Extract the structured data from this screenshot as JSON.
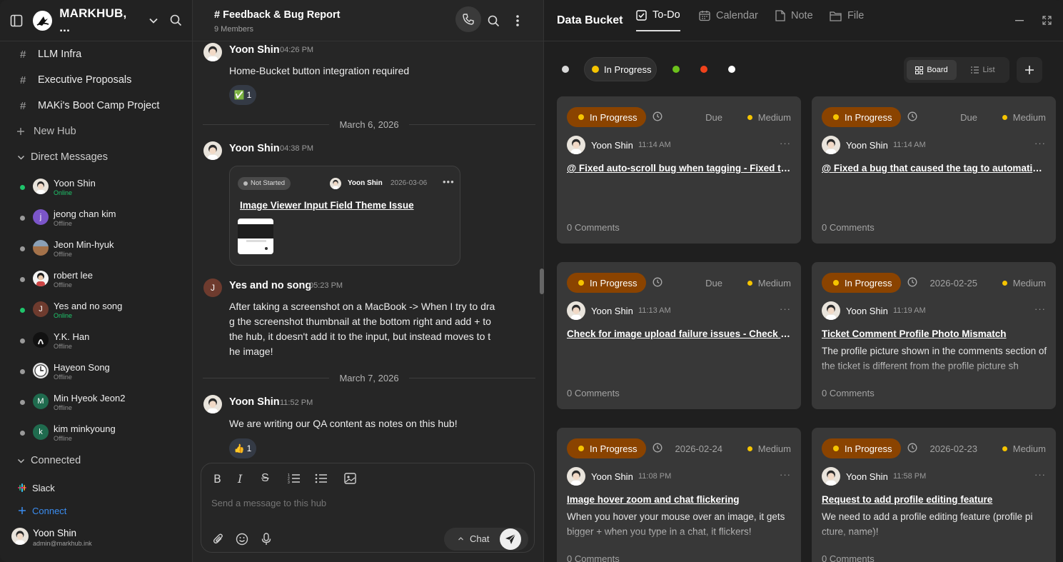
{
  "sidebar": {
    "workspace": "MARKHUB, ...",
    "channels": [
      {
        "label": "LLM Infra"
      },
      {
        "label": "Executive Proposals"
      },
      {
        "label": "MAKi's Boot Camp Project"
      }
    ],
    "new_hub": "New Hub",
    "direct_messages": "Direct Messages",
    "dms": [
      {
        "name": "Yoon Shin",
        "status": "Online"
      },
      {
        "name": "jeong chan kim",
        "status": "Offline"
      },
      {
        "name": "Jeon Min-hyuk",
        "status": "Offline"
      },
      {
        "name": "robert lee",
        "status": "Offline"
      },
      {
        "name": "Yes and no song",
        "status": "Online"
      },
      {
        "name": "Y.K. Han",
        "status": "Offline"
      },
      {
        "name": "Hayeon Song",
        "status": "Offline"
      },
      {
        "name": "Min Hyeok Jeon2",
        "status": "Offline"
      },
      {
        "name": "kim minkyoung",
        "status": "Offline"
      }
    ],
    "connected": "Connected",
    "slack": "Slack",
    "connect": "Connect",
    "user": {
      "name": "Yoon Shin",
      "email": "admin@markhub.ink"
    }
  },
  "chat": {
    "title": "# Feedback & Bug Report",
    "members": "9 Members",
    "messages": [
      {
        "name": "Yoon Shin",
        "time": "04:26 PM",
        "text": "Home-Bucket button integration required",
        "reaction": "✅",
        "count": "1"
      },
      {
        "name": "Yoon Shin",
        "time": "04:38 PM"
      },
      {
        "name": "Yes and no song",
        "time": "05:23 PM",
        "text": "After taking a screenshot on a MacBook -> When I try to dra g the screenshot thumbnail at the bottom right and add + to the hub, it doesn't add it to the input, but instead moves to t he image!"
      },
      {
        "name": "Yoon Shin",
        "time": "11:52 PM",
        "text": "We are writing our QA content as notes on this hub!",
        "reaction": "👍",
        "count": "1"
      }
    ],
    "dates": [
      "March 6, 2026",
      "March 7, 2026"
    ],
    "shared_card": {
      "status": "Not Started",
      "user": "Yoon Shin",
      "date": "2026-03-06",
      "title": "Image Viewer Input Field Theme Issue"
    },
    "placeholder": "Send a message to this hub",
    "chat_label": "Chat",
    "author_initial": "J"
  },
  "bucket": {
    "title": "Data Bucket",
    "tabs": [
      {
        "label": "To-Do"
      },
      {
        "label": "Calendar"
      },
      {
        "label": "Note"
      },
      {
        "label": "File"
      }
    ],
    "filter_active": "In Progress",
    "view_board": "Board",
    "view_list": "List",
    "cards": [
      {
        "status": "In Progress",
        "due": "Due",
        "priority": "Medium",
        "user": "Yoon Shin",
        "time": "11:14 AM",
        "title": "@ Fixed auto-scroll bug when tagging - Fixed the auto-scroll",
        "desc": "",
        "comments": "0 Comments"
      },
      {
        "status": "In Progress",
        "due": "Due",
        "priority": "Medium",
        "user": "Yoon Shin",
        "time": "11:14 AM",
        "title": "@ Fixed a bug that caused the tag to automatically close",
        "desc": "",
        "comments": "0 Comments"
      },
      {
        "status": "In Progress",
        "due": "Due",
        "priority": "Medium",
        "user": "Yoon Shin",
        "time": "11:13 AM",
        "title": "Check for image upload failure issues - Check for image",
        "desc": "",
        "comments": "0 Comments"
      },
      {
        "status": "In Progress",
        "due": "2026-02-25",
        "priority": "Medium",
        "user": "Yoon Shin",
        "time": "11:19 AM",
        "title": "Ticket Comment Profile Photo Mismatch",
        "desc": "The profile picture shown in the comments section of the ticket is different from the profile picture sh",
        "comments": "0 Comments"
      },
      {
        "status": "In Progress",
        "due": "2026-02-24",
        "priority": "Medium",
        "user": "Yoon Shin",
        "time": "11:08 PM",
        "title": "Image hover zoom and chat flickering",
        "desc": "When you hover your mouse over an image, it gets bigger + when you type in a chat, it flickers!",
        "comments": "0 Comments"
      },
      {
        "status": "In Progress",
        "due": "2026-02-23",
        "priority": "Medium",
        "user": "Yoon Shin",
        "time": "11:58 PM",
        "title": "Request to add profile editing feature",
        "desc": "We need to add a profile editing feature (profile pi cture, name)!",
        "comments": "0 Comments"
      }
    ]
  },
  "colors": {
    "online": "#1fc46b",
    "in_progress_badge": "#8a4300",
    "medium": "#f5c400",
    "filter_green": "#6cc11c",
    "filter_red": "#f0421b"
  }
}
